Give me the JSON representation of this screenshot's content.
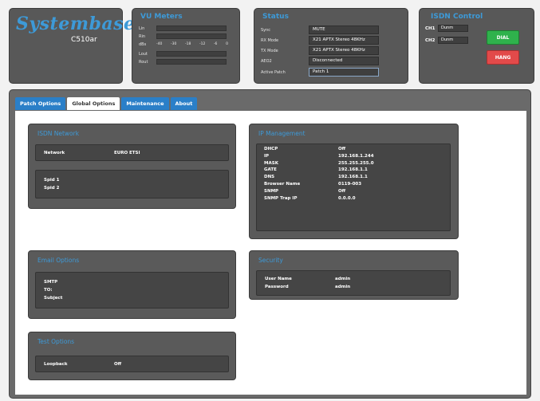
{
  "logo": {
    "name": "Systembase",
    "model": "C510ar"
  },
  "vu": {
    "title": "VU Meters",
    "rows": [
      {
        "label": "Lin"
      },
      {
        "label": "Rin"
      },
      {
        "label": "dBs"
      },
      {
        "label": "Lout"
      },
      {
        "label": "Rout"
      }
    ],
    "scale": [
      "-40",
      "-30",
      "-18",
      "-12",
      "-6",
      "0"
    ]
  },
  "status": {
    "title": "Status",
    "rows": [
      {
        "label": "Sync",
        "value": "MUTE"
      },
      {
        "label": "RX Mode",
        "value": "X21 APTX Stereo 48KHz"
      },
      {
        "label": "TX Mode",
        "value": "X21 APTX Stereo 48KHz"
      },
      {
        "label": "AEO2",
        "value": "Disconnected"
      },
      {
        "label": "Active Patch",
        "value": "Patch 1"
      }
    ]
  },
  "isdn_control": {
    "title": "ISDN Control",
    "channels": [
      {
        "label": "CH1",
        "value": "Dunm"
      },
      {
        "label": "CH2",
        "value": "Dunm"
      }
    ],
    "dial_label": "DIAL",
    "hang_label": "HANG"
  },
  "tabs": [
    "Patch Options",
    "Global Options",
    "Maintenance",
    "About"
  ],
  "active_tab": "Global Options",
  "isdn_network": {
    "title": "ISDN Network",
    "network_label": "Network",
    "network_value": "EURO ETSI",
    "spid1": "Spid 1",
    "spid2": "Spid 2"
  },
  "ip_management": {
    "title": "IP Management",
    "rows": [
      {
        "label": "DHCP",
        "value": "Off"
      },
      {
        "label": "IP",
        "value": "192.168.1.244"
      },
      {
        "label": "MASK",
        "value": "255.255.255.0"
      },
      {
        "label": "GATE",
        "value": "192.168.1.1"
      },
      {
        "label": "DNS",
        "value": "192.168.1.1"
      },
      {
        "label": "Browser Name",
        "value": "0119-003"
      },
      {
        "label": "SNMP",
        "value": "Off"
      },
      {
        "label": "SNMP Trap IP",
        "value": "0.0.0.0"
      }
    ]
  },
  "email_options": {
    "title": "Email Options",
    "smtp": "SMTP",
    "to": "TO:",
    "subject": "Subject"
  },
  "security": {
    "title": "Security",
    "user_label": "User Name",
    "user_value": "admin",
    "pass_label": "Password",
    "pass_value": "admin"
  },
  "test_options": {
    "title": "Test Options",
    "loopback_label": "Loopback",
    "loopback_value": "Off"
  }
}
